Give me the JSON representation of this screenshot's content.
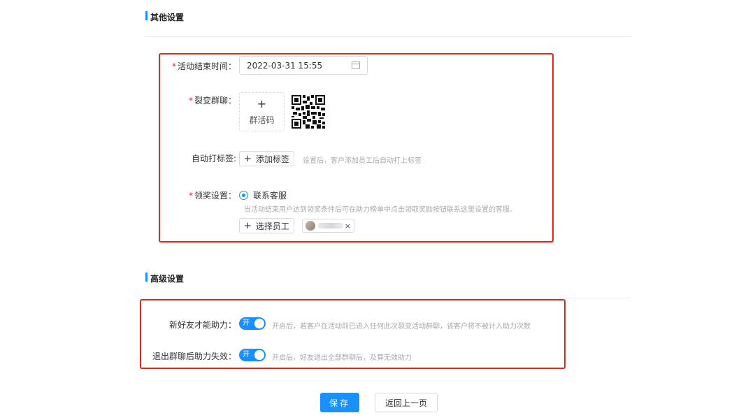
{
  "other_settings": {
    "title": "其他设置",
    "end_time": {
      "label": "活动结束时间：",
      "value": "2022-03-31 15:55",
      "icon": "calendar-icon"
    },
    "fission_group": {
      "label": "裂变群聊：",
      "upload_plus": "+",
      "upload_text": "群活码",
      "qr_icon": "qr-code-icon"
    },
    "auto_tag": {
      "label": "自动打标签:",
      "button_plus": "+",
      "button": "添加标签",
      "hint": "设置后，客户添加员工后自动打上标签"
    },
    "reward": {
      "label": "领奖设置：",
      "option": "联系客服",
      "hint": "当活动结束用户达到领奖条件后可在助力榜单中点击领取奖励按钮联系这里设置的客服。",
      "select_plus": "+",
      "select_button": "选择员工",
      "chip_close": "×"
    },
    "required_mark": "*"
  },
  "advanced_settings": {
    "title": "高级设置",
    "new_friend": {
      "label": "新好友才能助力：",
      "switch_text": "开",
      "hint": "开启后，若客户在活动前已进入任何此次裂变活动群聊，该客户将不被计入助力次数"
    },
    "leave_group": {
      "label": "退出群聊后助力失效：",
      "switch_text": "开",
      "hint": "开启后，好友退出全部群聊后，及算无效助力"
    }
  },
  "actions": {
    "save": "保存",
    "back": "返回上一页"
  },
  "colors": {
    "accent": "#1890ff",
    "highlight": "#e5261c",
    "required": "#f5222d"
  }
}
